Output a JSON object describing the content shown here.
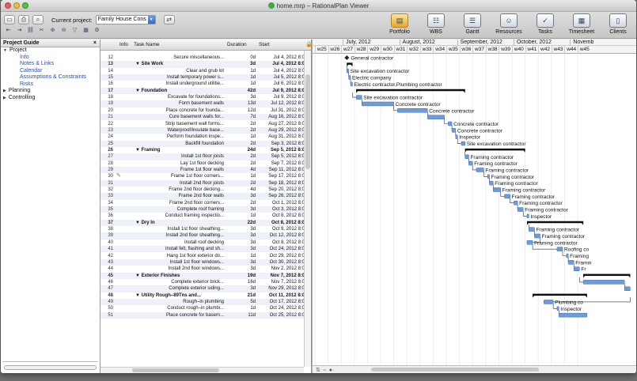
{
  "window": {
    "title": "home.mrp – RationalPlan Viewer"
  },
  "toolbar": {
    "project_label": "Current project:",
    "project_value": "Family House Cons",
    "views": [
      {
        "label": "Portfolio",
        "icon": "folder-icon"
      },
      {
        "label": "WBS",
        "icon": "wbs-icon"
      },
      {
        "label": "Gantt",
        "icon": "gantt-icon"
      },
      {
        "label": "Resources",
        "icon": "resources-icon"
      },
      {
        "label": "Tasks",
        "icon": "tasks-icon"
      },
      {
        "label": "Timesheet",
        "icon": "timesheet-icon"
      },
      {
        "label": "Clients",
        "icon": "clients-icon"
      }
    ]
  },
  "guide": {
    "title": "Project Guide",
    "close": "×",
    "items": [
      {
        "label": "Project",
        "level": 0,
        "expanded": true
      },
      {
        "label": "Info",
        "level": 1
      },
      {
        "label": "Notes & Links",
        "level": 1
      },
      {
        "label": "Calendar",
        "level": 1
      },
      {
        "label": "Assumptions & Constraints",
        "level": 1
      },
      {
        "label": "Risks",
        "level": 1
      },
      {
        "label": "Planning",
        "level": 0,
        "expanded": false
      },
      {
        "label": "Controlling",
        "level": 0,
        "expanded": false
      }
    ]
  },
  "grid": {
    "headers": {
      "info": "Info",
      "name": "Task Name",
      "duration": "Duration",
      "start": "Start"
    },
    "rows": [
      {
        "id": "12",
        "name": "Secure miscellaneous...",
        "dur": "0d",
        "start": "Jul 4, 2012 8:0",
        "summary": false
      },
      {
        "id": "13",
        "name": "▼ Site Work",
        "dur": "3d",
        "start": "Jul 4, 2012 8:0",
        "summary": true
      },
      {
        "id": "14",
        "name": "Clear and grub lot",
        "dur": "1d",
        "start": "Jul 4, 2012 8:0",
        "summary": false
      },
      {
        "id": "15",
        "name": "Install temporary power s...",
        "dur": "1d",
        "start": "Jul 5, 2012 8:0",
        "summary": false
      },
      {
        "id": "16",
        "name": "Install underground utilitie...",
        "dur": "1d",
        "start": "Jul 6, 2012 8:0",
        "summary": false
      },
      {
        "id": "17",
        "name": "▼ Foundation",
        "dur": "42d",
        "start": "Jul 9, 2012 8:0",
        "summary": true
      },
      {
        "id": "18",
        "name": "Excavate for foundations...",
        "dur": "3d",
        "start": "Jul 9, 2012 8:0",
        "summary": false
      },
      {
        "id": "19",
        "name": "Form basement walls",
        "dur": "13d",
        "start": "Jul 12, 2012 8:0",
        "summary": false
      },
      {
        "id": "20",
        "name": "Place concrete for founda...",
        "dur": "12d",
        "start": "Jul 31, 2012 8:0",
        "summary": false
      },
      {
        "id": "21",
        "name": "Cure basement walls for...",
        "dur": "7d",
        "start": "Aug 16, 2012 8:0",
        "summary": false
      },
      {
        "id": "22",
        "name": "Strip basement wall forms...",
        "dur": "2d",
        "start": "Aug 27, 2012 8:0",
        "summary": false
      },
      {
        "id": "23",
        "name": "Waterproof/insulate base...",
        "dur": "2d",
        "start": "Aug 29, 2012 8:0",
        "summary": false
      },
      {
        "id": "24",
        "name": "Perform foundation inspe...",
        "dur": "1d",
        "start": "Aug 31, 2012 8:0",
        "summary": false
      },
      {
        "id": "25",
        "name": "Backfill foundation",
        "dur": "2d",
        "start": "Sep 3, 2012 8:0",
        "summary": false
      },
      {
        "id": "26",
        "name": "▼ Framing",
        "dur": "24d",
        "start": "Sep 5, 2012 8:0",
        "summary": true
      },
      {
        "id": "27",
        "name": "Install 1st floor joists",
        "dur": "2d",
        "start": "Sep 5, 2012 8:0",
        "summary": false
      },
      {
        "id": "28",
        "name": "Lay 1st floor decking",
        "dur": "2d",
        "start": "Sep 7, 2012 8:0",
        "summary": false
      },
      {
        "id": "29",
        "name": "Frame 1st floor walls",
        "dur": "4d",
        "start": "Sep 11, 2012 8:0",
        "summary": false
      },
      {
        "id": "30",
        "name": "Frame 1st floor corners...",
        "dur": "1d",
        "start": "Sep 17, 2012 8:0",
        "summary": false,
        "info": "pencil"
      },
      {
        "id": "31",
        "name": "Install 2nd floor joists",
        "dur": "2d",
        "start": "Sep 18, 2012 8:0",
        "summary": false
      },
      {
        "id": "32",
        "name": "Frame 2nd floor decking...",
        "dur": "4d",
        "start": "Sep 20, 2012 8:0",
        "summary": false
      },
      {
        "id": "33",
        "name": "Frame 2nd floor walls",
        "dur": "3d",
        "start": "Sep 26, 2012 8:0",
        "summary": false
      },
      {
        "id": "34",
        "name": "Frame 2nd floor corners...",
        "dur": "2d",
        "start": "Oct 1, 2012 8:0",
        "summary": false
      },
      {
        "id": "35",
        "name": "Complete roof framing",
        "dur": "3d",
        "start": "Oct 3, 2012 8:0",
        "summary": false
      },
      {
        "id": "36",
        "name": "Conduct framing inspectio...",
        "dur": "1d",
        "start": "Oct 8, 2012 8:0",
        "summary": false
      },
      {
        "id": "37",
        "name": "▼ Dry In",
        "dur": "22d",
        "start": "Oct 8, 2012 8:0",
        "summary": true
      },
      {
        "id": "38",
        "name": "Install 1st floor sheathing...",
        "dur": "3d",
        "start": "Oct 9, 2012 8:0",
        "summary": false
      },
      {
        "id": "39",
        "name": "Install 2nd floor sheathing...",
        "dur": "3d",
        "start": "Oct 12, 2012 8:0",
        "summary": false
      },
      {
        "id": "40",
        "name": "Install roof decking",
        "dur": "3d",
        "start": "Oct 8, 2012 8:0",
        "summary": false
      },
      {
        "id": "41",
        "name": "Install felt, flashing and sh...",
        "dur": "3d",
        "start": "Oct 24, 2012 8:0",
        "summary": false
      },
      {
        "id": "42",
        "name": "Hang 1st floor exterior do...",
        "dur": "1d",
        "start": "Oct 29, 2012 8:0",
        "summary": false
      },
      {
        "id": "43",
        "name": "Install 1st floor windows...",
        "dur": "3d",
        "start": "Oct 30, 2012 8:0",
        "summary": false
      },
      {
        "id": "44",
        "name": "Install 2nd floor windows...",
        "dur": "3d",
        "start": "Nov 2, 2012 8:0",
        "summary": false
      },
      {
        "id": "45",
        "name": "▼ Exterior Finishes",
        "dur": "19d",
        "start": "Nov 7, 2012 8:0",
        "summary": true
      },
      {
        "id": "46",
        "name": "Complete exterior brick...",
        "dur": "16d",
        "start": "Nov 7, 2012 8:0",
        "summary": false
      },
      {
        "id": "47",
        "name": "Complete exterior siding...",
        "dur": "3d",
        "start": "Nov 29, 2012 8:0",
        "summary": false
      },
      {
        "id": "48",
        "name": "▼ Utility Rough–89Tns and...",
        "dur": "21d",
        "start": "Oct 11, 2012 8:0",
        "summary": true
      },
      {
        "id": "49",
        "name": "Rough–in plumbing",
        "dur": "5d",
        "start": "Oct 17, 2012 8:0",
        "summary": false
      },
      {
        "id": "50",
        "name": "Conduct rough–in plumbi...",
        "dur": "1d",
        "start": "Oct 24, 2012 8:0",
        "summary": false
      },
      {
        "id": "51",
        "name": "Place concrete for basem...",
        "dur": "11d",
        "start": "Oct 25, 2012 8:0",
        "summary": false
      }
    ]
  },
  "gantt": {
    "months": [
      "July, 2012",
      "August, 2012",
      "September, 2012",
      "October, 2012",
      "Novemb"
    ],
    "weeks": [
      "w25",
      "w26",
      "w27",
      "w28",
      "w29",
      "w30",
      "w31",
      "w32",
      "w33",
      "w34",
      "w35",
      "w36",
      "w37",
      "w38",
      "w39",
      "w40",
      "w41",
      "w42",
      "w43",
      "w44",
      "w45"
    ],
    "labels": {
      "12": "General contractor",
      "14": "Site excavation contractor",
      "15": "Electric company",
      "16": "Electric contractor,Plumbing contractor",
      "18": "Site excavation contractor",
      "19": "Concrete contractor",
      "20": "Concrete contractor",
      "22": "Concrete contractor",
      "23": "Concrete contractor",
      "24": "Inspector",
      "25": "Site excavation contractor",
      "27": "Framing contractor",
      "28": "Framing contractor",
      "29": "Framing contractor",
      "30": "Framing contractor",
      "31": "Framing contractor",
      "32": "Framing contractor",
      "33": "Framing contractor",
      "34": "Framing contractor",
      "35": "Framing contractor",
      "36": "Inspector",
      "38": "Framing contractor",
      "39": "Framing contractor",
      "40": "Framing contractor",
      "41": "Roofing co",
      "42": "Framing",
      "43": "Framin",
      "44": "Fr",
      "49": "Plumbing co",
      "50": "Inspector"
    }
  },
  "colors": {
    "bar": "#6f9bd8",
    "bar_edge": "#3b6fb8",
    "summary": "#111111",
    "link": "#333333"
  }
}
